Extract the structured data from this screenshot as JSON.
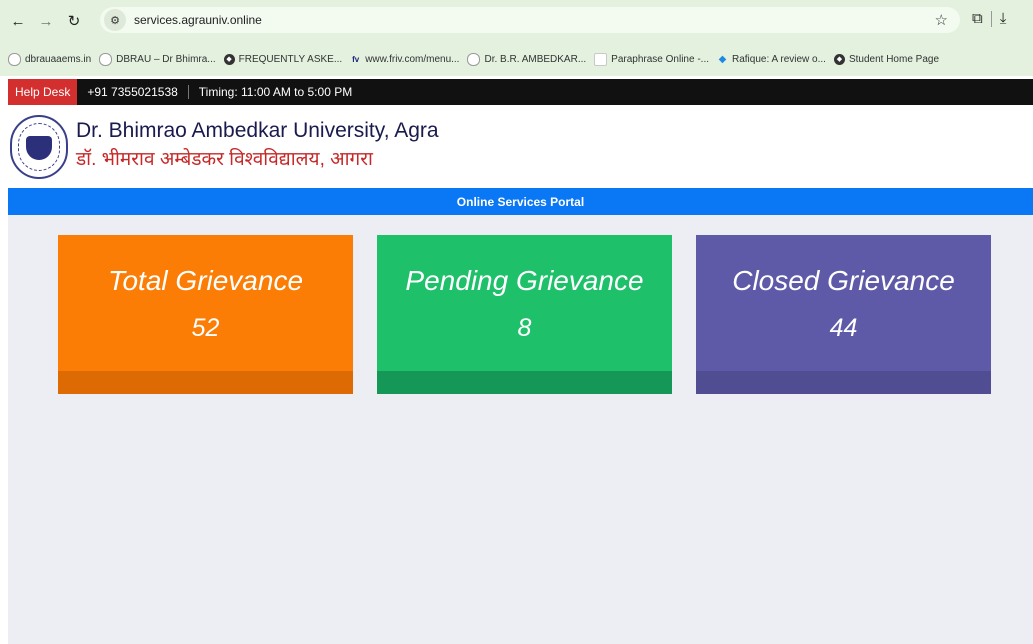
{
  "browser": {
    "url": "services.agrauniv.online",
    "bookmarks": [
      "dbrauaaems.in",
      "DBRAU – Dr Bhimra...",
      "FREQUENTLY ASKE...",
      "www.friv.com/menu...",
      "Dr. B.R. AMBEDKAR...",
      "Paraphrase Online -...",
      "Rafique: A review o...",
      "Student Home Page"
    ]
  },
  "helpdesk": {
    "label": "Help Desk",
    "phone": "+91 7355021538",
    "timing": "Timing: 11:00 AM to 5:00 PM"
  },
  "header": {
    "university_en": "Dr. Bhimrao Ambedkar University, Agra",
    "university_hi": "डॉ. भीमराव अम्बेडकर विश्वविद्यालय, आगरा"
  },
  "portal_title": "Online Services Portal",
  "cards": [
    {
      "title": "Total Grievance",
      "count": "52",
      "color": "#fb7d05"
    },
    {
      "title": "Pending Grievance",
      "count": "8",
      "color": "#1fc06a"
    },
    {
      "title": "Closed Grievance",
      "count": "44",
      "color": "#5f5aa8"
    }
  ]
}
